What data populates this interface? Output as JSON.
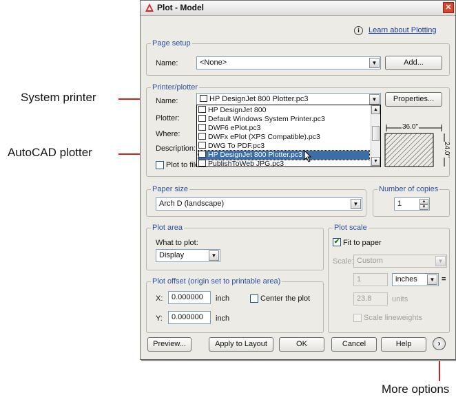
{
  "callouts": {
    "system_printer": "System printer",
    "autocad_plotter": "AutoCAD plotter",
    "more_options": "More options"
  },
  "dialog": {
    "title": "Plot - Model",
    "learn_link": "Learn about Plotting",
    "info_icon": "i"
  },
  "page_setup": {
    "group_title": "Page setup",
    "name_label": "Name:",
    "name_value": "<None>",
    "add_button": "Add..."
  },
  "printer": {
    "group_title": "Printer/plotter",
    "name_label": "Name:",
    "name_value": "HP DesignJet 800 Plotter.pc3",
    "properties_button": "Properties...",
    "plotter_label": "Plotter:",
    "where_label": "Where:",
    "description_label": "Description:",
    "plot_to_file_label": "Plot to file",
    "options": [
      "HP DesignJet 800",
      "Default Windows System Printer.pc3",
      "DWF6 ePlot.pc3",
      "DWFx ePlot (XPS Compatible).pc3",
      "DWG To PDF.pc3",
      "HP DesignJet 800 Plotter.pc3",
      "PublishToWeb JPG.pc3"
    ],
    "selected_index": 5,
    "preview_width_label": "36.0\"",
    "preview_height_label": "24.0\""
  },
  "paper_size": {
    "group_title": "Paper size",
    "value": "Arch D (landscape)"
  },
  "copies": {
    "group_title": "Number of copies",
    "value": "1"
  },
  "plot_area": {
    "group_title": "Plot area",
    "what_label": "What to plot:",
    "value": "Display"
  },
  "plot_offset": {
    "group_title": "Plot offset (origin set to printable area)",
    "x_label": "X:",
    "x_value": "0.000000",
    "x_unit": "inch",
    "y_label": "Y:",
    "y_value": "0.000000",
    "y_unit": "inch",
    "center_label": "Center the plot"
  },
  "plot_scale": {
    "group_title": "Plot scale",
    "fit_label": "Fit to paper",
    "fit_checked": true,
    "scale_label": "Scale:",
    "scale_value": "Custom",
    "inches_top": "1",
    "inches_unit": "inches",
    "units_value": "23.8",
    "units_label": "units",
    "equals": "=",
    "scale_lineweights": "Scale lineweights"
  },
  "buttons": {
    "preview": "Preview...",
    "apply": "Apply to Layout",
    "ok": "OK",
    "cancel": "Cancel",
    "help": "Help"
  },
  "colors": {
    "group_title": "#2b4fa0",
    "leader": "#cc1f1f",
    "selection": "#3a6ea5",
    "link": "#1a3a9c"
  }
}
